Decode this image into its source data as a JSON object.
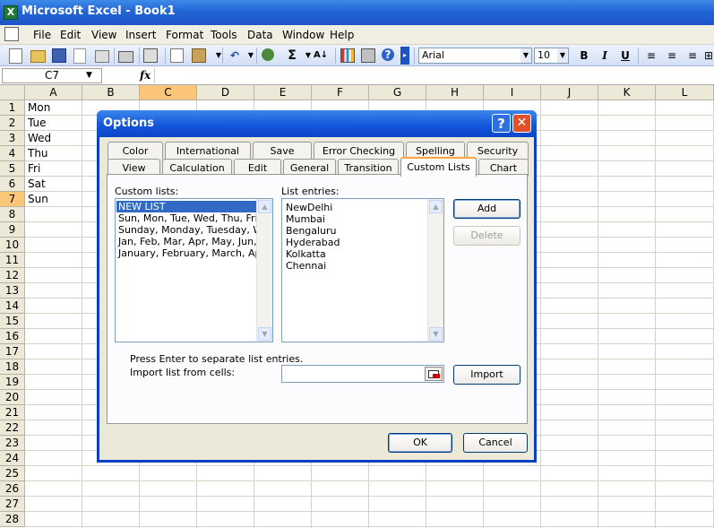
{
  "window": {
    "title": "Microsoft Excel - Book1",
    "app_icon_glyph": "X"
  },
  "menu": [
    "File",
    "Edit",
    "View",
    "Insert",
    "Format",
    "Tools",
    "Data",
    "Window",
    "Help"
  ],
  "toolbar": {
    "font_name": "Arial",
    "font_size": "10",
    "bold": "B",
    "italic": "I",
    "underline": "U",
    "sigma": "Σ"
  },
  "formula_bar": {
    "name_box": "C7",
    "fx": "fx",
    "formula": ""
  },
  "columns": [
    "A",
    "B",
    "C",
    "D",
    "E",
    "F",
    "G",
    "H",
    "I",
    "J",
    "K",
    "L"
  ],
  "rows": [
    "1",
    "2",
    "3",
    "4",
    "5",
    "6",
    "7",
    "8",
    "9",
    "10",
    "11",
    "12",
    "13",
    "14",
    "15",
    "16",
    "17",
    "18",
    "19",
    "20",
    "21",
    "22",
    "23",
    "24",
    "25",
    "26",
    "27",
    "28"
  ],
  "cells": [
    "Mon",
    "Tue",
    "Wed",
    "Thu",
    "Fri",
    "Sat",
    "Sun"
  ],
  "selected": {
    "column": "C",
    "row": "7"
  },
  "dialog": {
    "title": "Options",
    "help": "?",
    "close": "✕",
    "tabs_back": [
      "Color",
      "International",
      "Save",
      "Error Checking",
      "Spelling",
      "Security"
    ],
    "tabs_front": [
      "View",
      "Calculation",
      "Edit",
      "General",
      "Transition",
      "Custom Lists",
      "Chart"
    ],
    "active_tab": "Custom Lists",
    "custom_lists_label": "Custom lists:",
    "custom_lists": [
      "NEW LIST",
      "Sun, Mon, Tue, Wed, Thu, Fri, Sat",
      "Sunday, Monday, Tuesday, Wednesday",
      "Jan, Feb, Mar, Apr, May, Jun, Jul",
      "January, February, March, April"
    ],
    "list_entries_label": "List entries:",
    "list_entries": [
      "NewDelhi",
      "Mumbai",
      "Bengaluru",
      "Hyderabad",
      "Kolkatta",
      "Chennai"
    ],
    "add": "Add",
    "delete": "Delete",
    "hint": "Press Enter to separate list entries.",
    "import_label": "Import list from cells:",
    "import_value": "",
    "import_button": "Import",
    "ok": "OK",
    "cancel": "Cancel"
  }
}
